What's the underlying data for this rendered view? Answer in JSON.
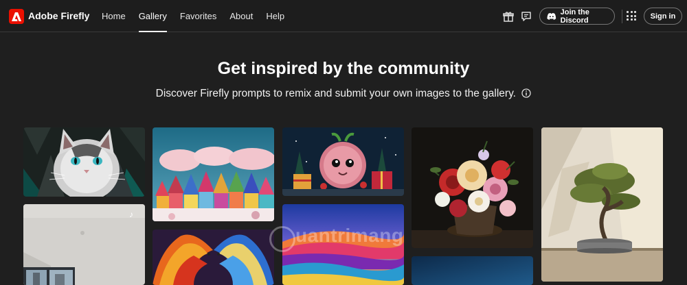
{
  "header": {
    "brand": "Adobe Firefly",
    "nav": [
      {
        "label": "Home",
        "active": false
      },
      {
        "label": "Gallery",
        "active": true
      },
      {
        "label": "Favorites",
        "active": false
      },
      {
        "label": "About",
        "active": false
      },
      {
        "label": "Help",
        "active": false
      }
    ],
    "discord_label": "Join the Discord",
    "signin_label": "Sign in",
    "icons": [
      "gift-icon",
      "feedback-icon",
      "discord-icon",
      "apps-icon"
    ]
  },
  "hero": {
    "title": "Get inspired by the community",
    "subtitle": "Discover Firefly prompts to remix and submit your own images to the gallery."
  },
  "gallery": {
    "tiles": [
      "gallery-tile-cat",
      "gallery-tile-colorful-village",
      "gallery-tile-fluffy-creature",
      "gallery-tile-flower-bouquet",
      "gallery-tile-bonsai",
      "gallery-tile-room-video",
      "gallery-tile-phoenix-birds",
      "gallery-tile-rainbow-landscape",
      "gallery-tile-night-sky"
    ]
  },
  "watermark": "uantrimang",
  "colors": {
    "accent": "#eb1000",
    "background": "#1f1f1f"
  }
}
